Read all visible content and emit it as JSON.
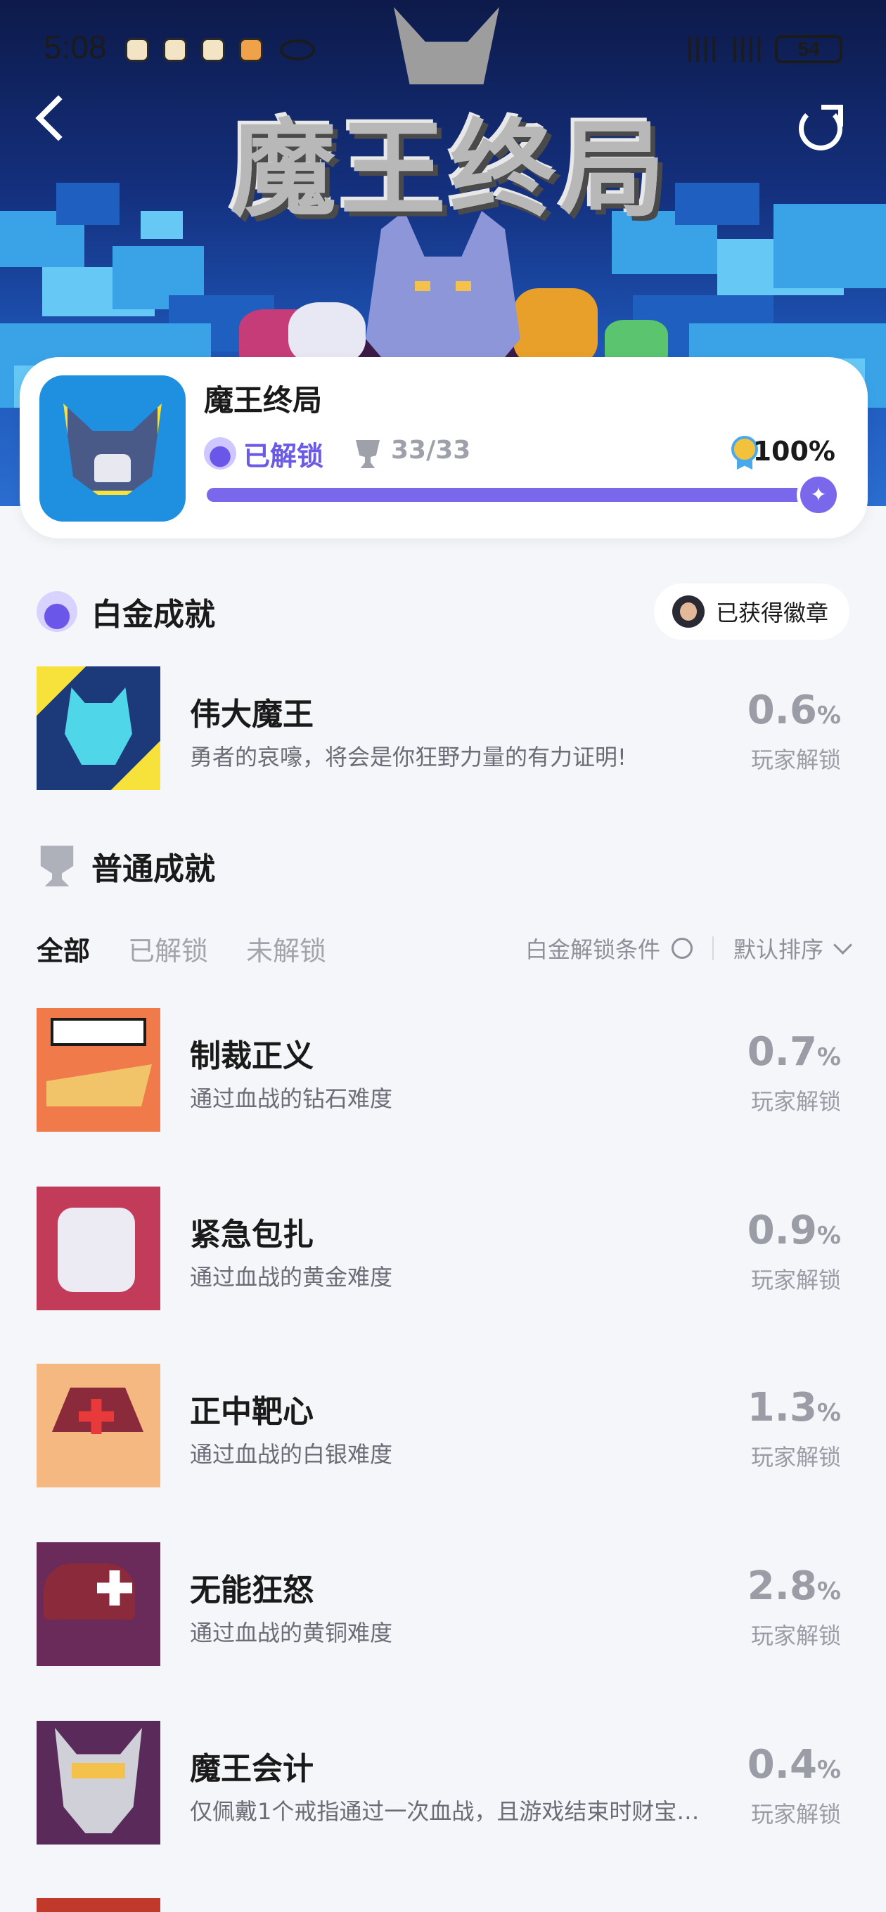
{
  "status_bar": {
    "time": "5:08",
    "battery": "54"
  },
  "hero": {
    "title": "魔王终局"
  },
  "summary": {
    "game_name": "魔王终局",
    "unlocked_label": "已解锁",
    "trophy_count": "33/33",
    "completion": "100%",
    "progress_fraction": 1.0
  },
  "platinum": {
    "section_title": "白金成就",
    "badge_button": "已获得徽章",
    "item": {
      "name": "伟大魔王",
      "desc": "勇者的哀嚎，将会是你狂野力量的有力证明!",
      "percent": "0.6",
      "percent_unit": "%",
      "percent_label": "玩家解锁"
    }
  },
  "normal": {
    "section_title": "普通成就",
    "tabs": [
      "全部",
      "已解锁",
      "未解锁"
    ],
    "filter_condition": "白金解锁条件",
    "sort_label": "默认排序",
    "items": [
      {
        "name": "制裁正义",
        "desc": "通过血战的钻石难度",
        "percent": "0.7",
        "percent_unit": "%",
        "percent_label": "玩家解锁"
      },
      {
        "name": "紧急包扎",
        "desc": "通过血战的黄金难度",
        "percent": "0.9",
        "percent_unit": "%",
        "percent_label": "玩家解锁"
      },
      {
        "name": "正中靶心",
        "desc": "通过血战的白银难度",
        "percent": "1.3",
        "percent_unit": "%",
        "percent_label": "玩家解锁"
      },
      {
        "name": "无能狂怒",
        "desc": "通过血战的黄铜难度",
        "percent": "2.8",
        "percent_unit": "%",
        "percent_label": "玩家解锁"
      },
      {
        "name": "魔王会计",
        "desc": "仅佩戴1个戒指通过一次血战，且游戏结束时财宝…",
        "percent": "0.4",
        "percent_unit": "%",
        "percent_label": "玩家解锁"
      }
    ]
  },
  "colors": {
    "accent": "#7a68ec",
    "muted": "#9a9ca6"
  },
  "icons": [
    "back-icon",
    "share-icon",
    "trophy-icon",
    "medal-icon",
    "platinum-icon",
    "help-circle-icon",
    "chevron-down-icon"
  ]
}
